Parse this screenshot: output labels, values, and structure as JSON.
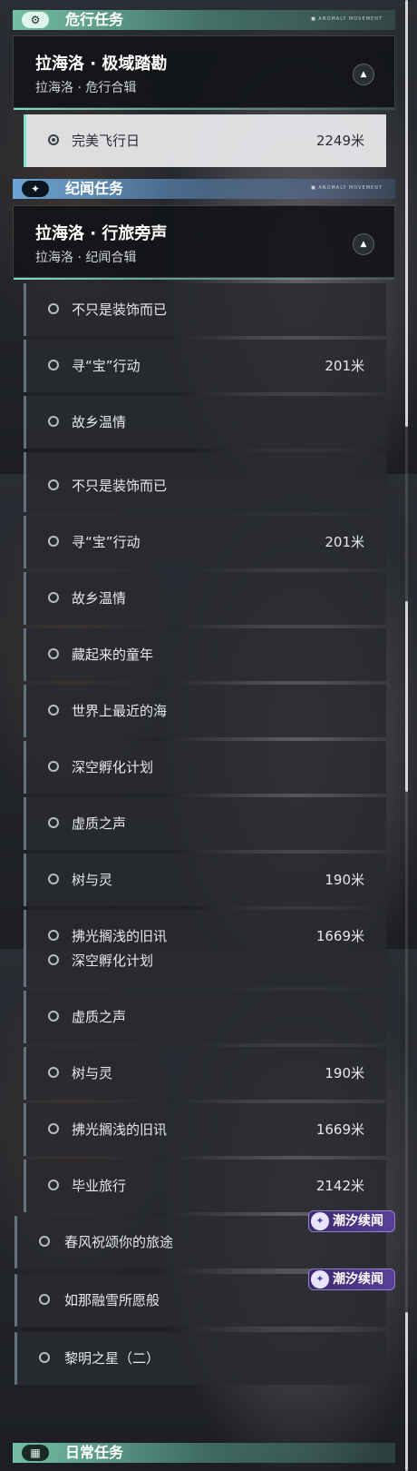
{
  "danger": {
    "title": "危行任务",
    "icon": "gear-icon",
    "tag": "■ ANOMALY MOVEMENT",
    "chapter_title": "拉海洛 · 极域踏勘",
    "chapter_sub": "拉海洛 · 危行合辑",
    "quest": {
      "name": "完美飞行日",
      "distance": "2249米"
    }
  },
  "lore": {
    "title": "纪闻任务",
    "icon": "star-icon",
    "tag": "■ ANOMALY MOVEMENT",
    "chapter_title": "拉海洛 · 行旅旁声",
    "chapter_sub": "拉海洛 · 纪闻合辑"
  },
  "quests": [
    {
      "name": "不只是装饰而已",
      "distance": ""
    },
    {
      "name": "寻“宝”行动",
      "distance": "201米"
    },
    {
      "name": "故乡温情",
      "distance": ""
    },
    {
      "name": "藏起来的童年",
      "distance": ""
    },
    {
      "name": "世界上最近的海",
      "distance": ""
    },
    {
      "name": "深空孵化计划",
      "distance": ""
    },
    {
      "name": "虚质之声",
      "distance": ""
    },
    {
      "name": "树与灵",
      "distance": "190米"
    },
    {
      "name": "拂光搁浅的旧讯",
      "distance": "1669米"
    },
    {
      "name": "毕业旅行",
      "distance": "2142米"
    }
  ],
  "tide_quests": [
    {
      "name": "春风祝颂你的旅途",
      "badge": "潮汐续闻"
    },
    {
      "name": "如那融雪所愿般",
      "badge": "潮汐续闻"
    },
    {
      "name": "黎明之星（二）",
      "badge": ""
    }
  ],
  "daily": {
    "title": "日常任务"
  }
}
